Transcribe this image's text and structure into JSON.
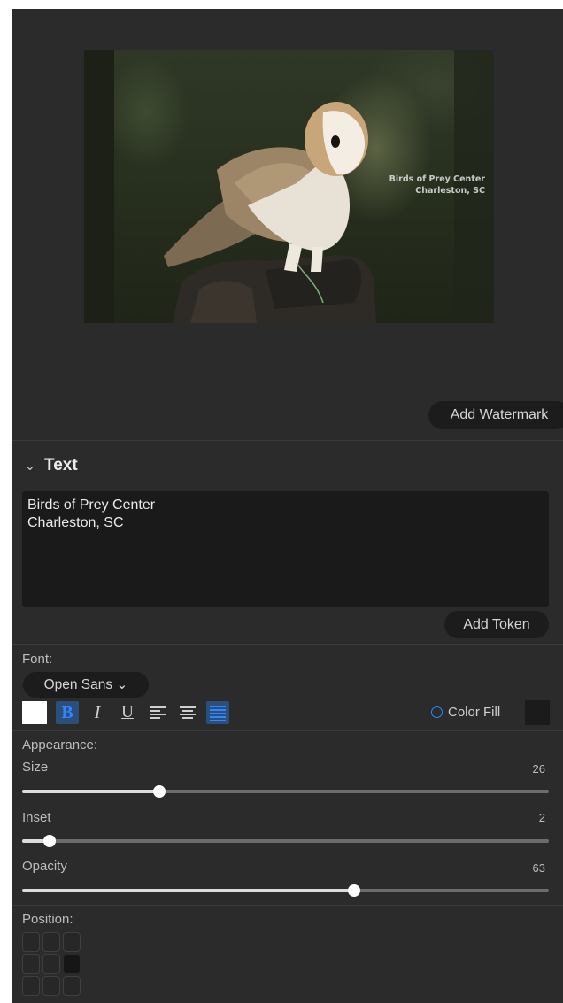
{
  "preview": {
    "watermark_lines": [
      "Birds of Prey Center",
      "Charleston, SC"
    ]
  },
  "buttons": {
    "add_watermark": "Add Watermark",
    "add_token": "Add Token"
  },
  "section": {
    "chevron": "⌄",
    "title": "Text"
  },
  "text_input": {
    "lines": [
      "Birds of Prey Center",
      "Charleston, SC"
    ]
  },
  "font": {
    "label": "Font:",
    "selected": "Open Sans ⌄"
  },
  "formatting": {
    "text_color": "#ffffff",
    "bold_glyph": "B",
    "italic_glyph": "I",
    "underline_glyph": "U",
    "bold_active": true,
    "alignment_active": "right",
    "icons": [
      "align-left-icon",
      "align-center-icon",
      "align-right-icon"
    ]
  },
  "color_fill": {
    "label": "Color Fill",
    "enabled": false,
    "swatch": "#1b1b1b"
  },
  "appearance": {
    "label": "Appearance:",
    "size": {
      "label": "Size",
      "value": "26",
      "fraction": 0.26
    },
    "inset": {
      "label": "Inset",
      "value": "2",
      "fraction": 0.052
    },
    "opacity": {
      "label": "Opacity",
      "value": "63",
      "fraction": 0.63
    }
  },
  "position": {
    "label": "Position:",
    "selected_cell": 5
  },
  "colors": {
    "accent": "#2f86ff",
    "panel": "#2b2b2b",
    "field": "#1a1a1a"
  }
}
